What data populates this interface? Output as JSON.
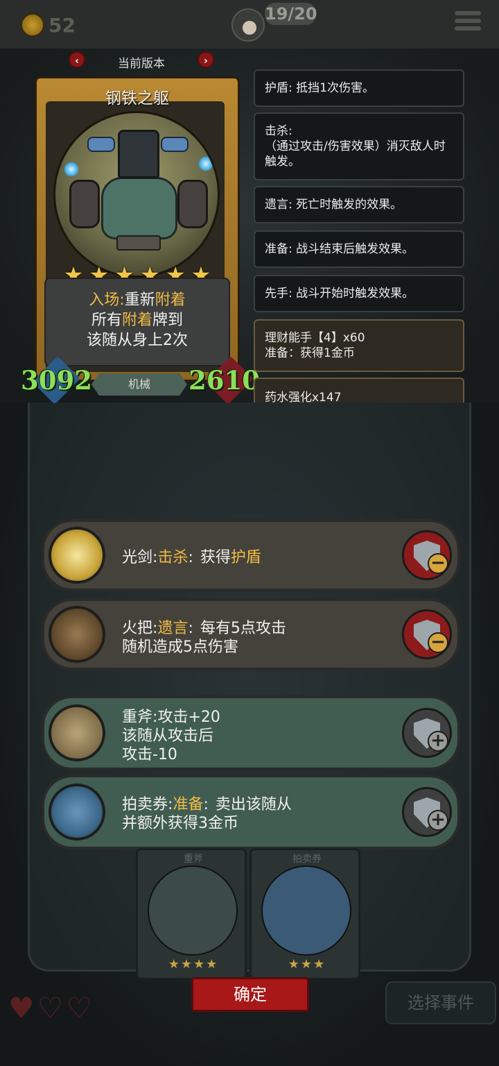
{
  "top_bar": {
    "coins": "52",
    "progress": "19/20",
    "icons": [
      "coin-icon",
      "avatar-icon",
      "menu-icon"
    ]
  },
  "version": {
    "label": "当前版本",
    "prev_icon": "chevron-left-icon",
    "next_icon": "chevron-right-icon"
  },
  "card": {
    "name": "钢铁之躯",
    "stars": 6,
    "desc": {
      "line1_kw1": "入场",
      "line1_sep": ":",
      "line1_rest": "重新",
      "line1_kw2": "附着",
      "line2_pre": "所有",
      "line2_kw": "附着",
      "line2_post": "牌到",
      "line3": "该随从身上2次"
    },
    "attack": "3092",
    "health": "2610",
    "tribe": "机械"
  },
  "glossary": [
    {
      "title": "护盾: 抵挡1次伤害。",
      "body": ""
    },
    {
      "title": "击杀:",
      "body": "（通过攻击/伤害效果）消灭敌人时触发。"
    },
    {
      "title": "遗言: 死亡时触发的效果。",
      "body": ""
    },
    {
      "title": "准备: 战斗结束后触发效果。",
      "body": ""
    },
    {
      "title": "先手: 战斗开始时触发效果。",
      "body": ""
    },
    {
      "title": "理财能手【4】x60",
      "body": "准备：获得1金币"
    },
    {
      "title": "药水强化x147",
      "body": ""
    }
  ],
  "effects": [
    {
      "name": "光剑",
      "sep": ":",
      "kw": "击杀",
      "colon": ":",
      "text_a": "获得",
      "kw2": "护盾",
      "line2": "",
      "line3": "",
      "action": "remove",
      "icon": "light-sword-icon"
    },
    {
      "name": "火把",
      "sep": ":",
      "kw": "遗言",
      "colon": ":",
      "text_a": "每有5点攻击",
      "kw2": "",
      "line2": "随机造成5点伤害",
      "line3": "",
      "action": "remove",
      "icon": "torch-icon"
    },
    {
      "name": "重斧",
      "sep": ":",
      "kw": "",
      "colon": "",
      "text_a": "攻击+20",
      "kw2": "",
      "line2": "该随从攻击后",
      "line3": "攻击-10",
      "action": "add",
      "icon": "heavy-axe-icon"
    },
    {
      "name": "拍卖券",
      "sep": ":",
      "kw": "准备",
      "colon": ":",
      "text_a": "卖出该随从",
      "kw2": "",
      "line2": "并额外获得3金币",
      "line3": "",
      "action": "add",
      "icon": "auction-ticket-icon"
    }
  ],
  "bottom": {
    "slot1_label": "重斧",
    "slot2_label": "拍卖券",
    "slot1_stars": "★★★★",
    "slot2_stars": "★★★",
    "confirm": "确定",
    "select_event": "选择事件"
  },
  "colors": {
    "keyword": "#f0bc46",
    "stat_green": "#8dde5a",
    "remove_red": "#8e1b1b",
    "confirm_red": "#a81818"
  }
}
